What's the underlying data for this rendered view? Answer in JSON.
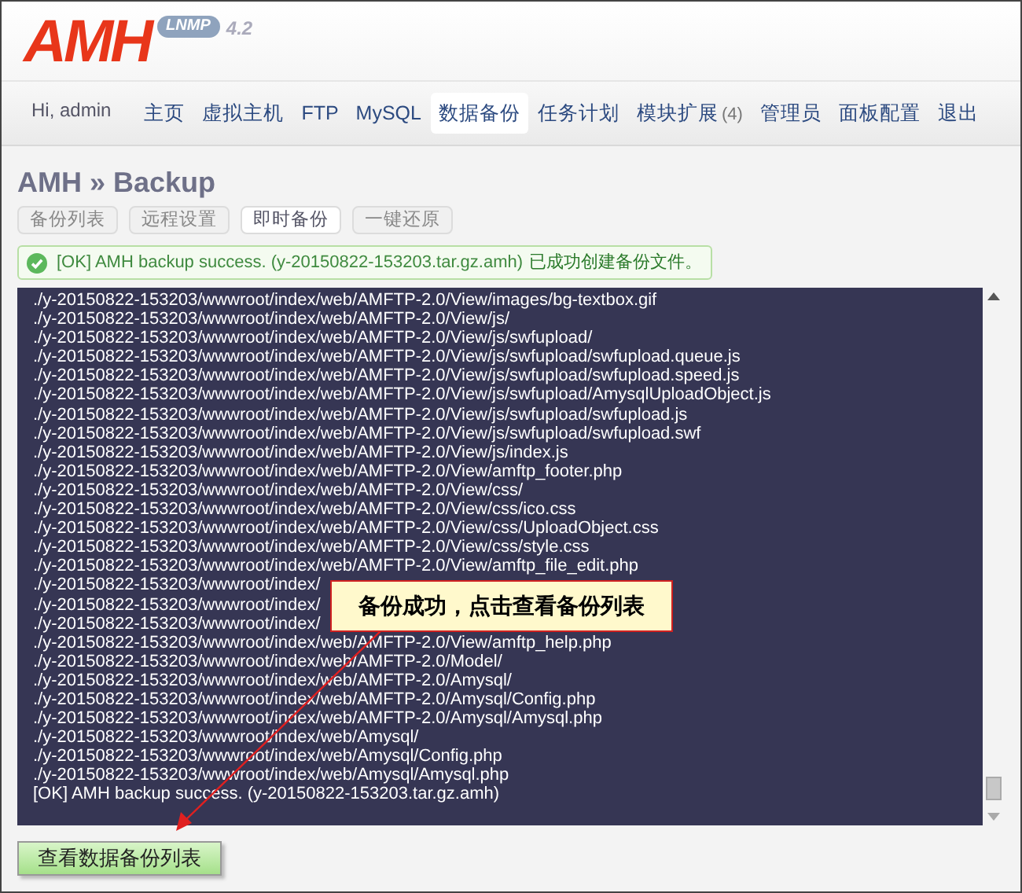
{
  "header": {
    "logo": "AMH",
    "badge": "LNMP",
    "version": "4.2"
  },
  "nav": {
    "greeting": "Hi, admin",
    "items": [
      {
        "label": "主页",
        "selected": false
      },
      {
        "label": "虚拟主机",
        "selected": false
      },
      {
        "label": "FTP",
        "selected": false
      },
      {
        "label": "MySQL",
        "selected": false
      },
      {
        "label": "数据备份",
        "selected": true
      },
      {
        "label": "任务计划",
        "selected": false
      },
      {
        "label": "模块扩展",
        "count": "(4)",
        "selected": false
      },
      {
        "label": "管理员",
        "selected": false
      },
      {
        "label": "面板配置",
        "selected": false
      },
      {
        "label": "退出",
        "selected": false
      }
    ]
  },
  "page_title": "AMH » Backup",
  "tabs": [
    {
      "label": "备份列表",
      "selected": false
    },
    {
      "label": "远程设置",
      "selected": false
    },
    {
      "label": "即时备份",
      "selected": true
    },
    {
      "label": "一键还原",
      "selected": false
    }
  ],
  "alert": {
    "text": "[OK] AMH backup success. (y-20150822-153203.tar.gz.amh)",
    "note": "已成功创建备份文件。"
  },
  "log_lines": [
    "./y-20150822-153203/wwwroot/index/web/AMFTP-2.0/View/images/bg-textbox.gif",
    "./y-20150822-153203/wwwroot/index/web/AMFTP-2.0/View/js/",
    "./y-20150822-153203/wwwroot/index/web/AMFTP-2.0/View/js/swfupload/",
    "./y-20150822-153203/wwwroot/index/web/AMFTP-2.0/View/js/swfupload/swfupload.queue.js",
    "./y-20150822-153203/wwwroot/index/web/AMFTP-2.0/View/js/swfupload/swfupload.speed.js",
    "./y-20150822-153203/wwwroot/index/web/AMFTP-2.0/View/js/swfupload/AmysqlUploadObject.js",
    "./y-20150822-153203/wwwroot/index/web/AMFTP-2.0/View/js/swfupload/swfupload.js",
    "./y-20150822-153203/wwwroot/index/web/AMFTP-2.0/View/js/swfupload/swfupload.swf",
    "./y-20150822-153203/wwwroot/index/web/AMFTP-2.0/View/js/index.js",
    "./y-20150822-153203/wwwroot/index/web/AMFTP-2.0/View/amftp_footer.php",
    "./y-20150822-153203/wwwroot/index/web/AMFTP-2.0/View/css/",
    "./y-20150822-153203/wwwroot/index/web/AMFTP-2.0/View/css/ico.css",
    "./y-20150822-153203/wwwroot/index/web/AMFTP-2.0/View/css/UploadObject.css",
    "./y-20150822-153203/wwwroot/index/web/AMFTP-2.0/View/css/style.css",
    "./y-20150822-153203/wwwroot/index/web/AMFTP-2.0/View/amftp_file_edit.php",
    "./y-20150822-153203/wwwroot/index/",
    "./y-20150822-153203/wwwroot/index/",
    "./y-20150822-153203/wwwroot/index/",
    "./y-20150822-153203/wwwroot/index/web/AMFTP-2.0/View/amftp_help.php",
    "./y-20150822-153203/wwwroot/index/web/AMFTP-2.0/Model/",
    "./y-20150822-153203/wwwroot/index/web/AMFTP-2.0/Amysql/",
    "./y-20150822-153203/wwwroot/index/web/AMFTP-2.0/Amysql/Config.php",
    "./y-20150822-153203/wwwroot/index/web/AMFTP-2.0/Amysql/Amysql.php",
    "./y-20150822-153203/wwwroot/index/web/Amysql/",
    "./y-20150822-153203/wwwroot/index/web/Amysql/Config.php",
    "./y-20150822-153203/wwwroot/index/web/Amysql/Amysql.php",
    "[OK] AMH backup success. (y-20150822-153203.tar.gz.amh)"
  ],
  "callout": "备份成功，点击查看备份列表",
  "action_button": "查看数据备份列表"
}
